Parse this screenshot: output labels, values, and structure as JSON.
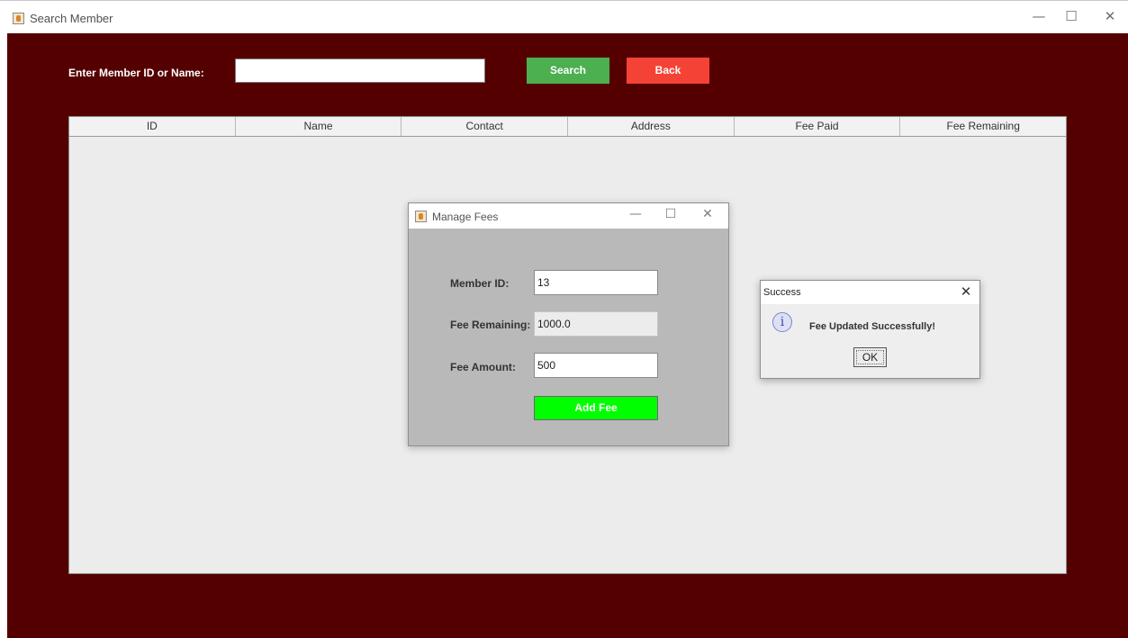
{
  "window": {
    "title": "Search Member",
    "controls": {
      "minimize": "—",
      "maximize": "☐",
      "close": "✕"
    }
  },
  "search": {
    "label": "Enter Member ID or Name:",
    "input_value": "",
    "search_button": "Search",
    "back_button": "Back"
  },
  "table": {
    "columns": [
      "ID",
      "Name",
      "Contact",
      "Address",
      "Fee Paid",
      "Fee Remaining"
    ],
    "rows": []
  },
  "manage_fees": {
    "title": "Manage Fees",
    "controls": {
      "minimize": "—",
      "maximize": "☐",
      "close": "✕"
    },
    "member_id_label": "Member ID:",
    "member_id_value": "13",
    "fee_remaining_label": "Fee Remaining:",
    "fee_remaining_value": "1000.0",
    "fee_amount_label": "Fee Amount:",
    "fee_amount_value": "500",
    "add_fee_button": "Add Fee"
  },
  "success_dialog": {
    "title": "Success",
    "close": "✕",
    "icon": "i",
    "message": "Fee Updated Successfully!",
    "ok_button": "OK"
  },
  "colors": {
    "frame_background": "#550000",
    "search_button": "#4caf50",
    "back_button": "#f44336",
    "add_fee_button": "#00ff00",
    "dialog_body": "#b9b9b9",
    "table_background": "#ececec"
  },
  "icons": {
    "app_icon": "java-coffee-icon",
    "info_icon": "information-icon"
  }
}
